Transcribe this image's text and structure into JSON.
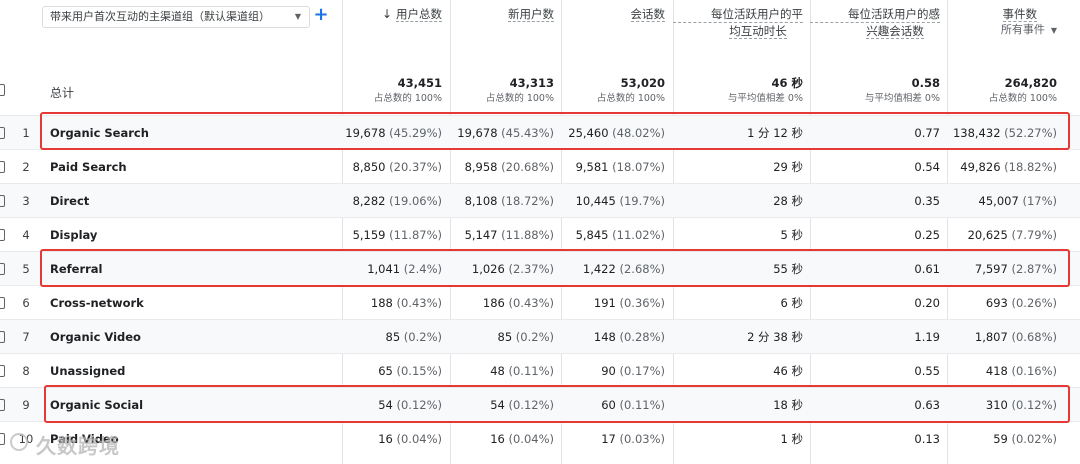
{
  "toolbar": {
    "dimension_select_label": "带来用户首次互动的主渠道组（默认渠道组）",
    "add_dimension_label": "+"
  },
  "columns": [
    {
      "key": "users",
      "label": "用户总数",
      "sorted_desc": true
    },
    {
      "key": "new_users",
      "label": "新用户数"
    },
    {
      "key": "sessions",
      "label": "会话数"
    },
    {
      "key": "avg_engagement",
      "label_line1": "每位活跃用户的平",
      "label_line2": "均互动时长"
    },
    {
      "key": "engaged_sessions",
      "label_line1": "每位活跃用户的感",
      "label_line2": "兴趣会话数"
    },
    {
      "key": "events",
      "label_line1": "事件数",
      "label_line2": "所有事件"
    }
  ],
  "totals": {
    "label": "总计",
    "users": {
      "value": "43,451",
      "pct": "占总数的 100%"
    },
    "new_users": {
      "value": "43,313",
      "pct": "占总数的 100%"
    },
    "sessions": {
      "value": "53,020",
      "pct": "占总数的 100%"
    },
    "avg_engagement": {
      "value": "46 秒",
      "pct": "与平均值相差 0%"
    },
    "engaged_sessions": {
      "value": "0.58",
      "pct": "与平均值相差 0%"
    },
    "events": {
      "value": "264,820",
      "pct": "占总数的 100%"
    }
  },
  "rows": [
    {
      "idx": "1",
      "name": "Organic Search",
      "users": "19,678",
      "users_pct": "(45.29%)",
      "new_users": "19,678",
      "new_users_pct": "(45.43%)",
      "sessions": "25,460",
      "sessions_pct": "(48.02%)",
      "avg_engagement": "1 分 12 秒",
      "engaged_sessions": "0.77",
      "events": "138,432",
      "events_pct": "(52.27%)"
    },
    {
      "idx": "2",
      "name": "Paid Search",
      "users": "8,850",
      "users_pct": "(20.37%)",
      "new_users": "8,958",
      "new_users_pct": "(20.68%)",
      "sessions": "9,581",
      "sessions_pct": "(18.07%)",
      "avg_engagement": "29 秒",
      "engaged_sessions": "0.54",
      "events": "49,826",
      "events_pct": "(18.82%)"
    },
    {
      "idx": "3",
      "name": "Direct",
      "users": "8,282",
      "users_pct": "(19.06%)",
      "new_users": "8,108",
      "new_users_pct": "(18.72%)",
      "sessions": "10,445",
      "sessions_pct": "(19.7%)",
      "avg_engagement": "28 秒",
      "engaged_sessions": "0.35",
      "events": "45,007",
      "events_pct": "(17%)"
    },
    {
      "idx": "4",
      "name": "Display",
      "users": "5,159",
      "users_pct": "(11.87%)",
      "new_users": "5,147",
      "new_users_pct": "(11.88%)",
      "sessions": "5,845",
      "sessions_pct": "(11.02%)",
      "avg_engagement": "5 秒",
      "engaged_sessions": "0.25",
      "events": "20,625",
      "events_pct": "(7.79%)"
    },
    {
      "idx": "5",
      "name": "Referral",
      "users": "1,041",
      "users_pct": "(2.4%)",
      "new_users": "1,026",
      "new_users_pct": "(2.37%)",
      "sessions": "1,422",
      "sessions_pct": "(2.68%)",
      "avg_engagement": "55 秒",
      "engaged_sessions": "0.61",
      "events": "7,597",
      "events_pct": "(2.87%)"
    },
    {
      "idx": "6",
      "name": "Cross-network",
      "users": "188",
      "users_pct": "(0.43%)",
      "new_users": "186",
      "new_users_pct": "(0.43%)",
      "sessions": "191",
      "sessions_pct": "(0.36%)",
      "avg_engagement": "6 秒",
      "engaged_sessions": "0.20",
      "events": "693",
      "events_pct": "(0.26%)"
    },
    {
      "idx": "7",
      "name": "Organic Video",
      "users": "85",
      "users_pct": "(0.2%)",
      "new_users": "85",
      "new_users_pct": "(0.2%)",
      "sessions": "148",
      "sessions_pct": "(0.28%)",
      "avg_engagement": "2 分 38 秒",
      "engaged_sessions": "1.19",
      "events": "1,807",
      "events_pct": "(0.68%)"
    },
    {
      "idx": "8",
      "name": "Unassigned",
      "users": "65",
      "users_pct": "(0.15%)",
      "new_users": "48",
      "new_users_pct": "(0.11%)",
      "sessions": "90",
      "sessions_pct": "(0.17%)",
      "avg_engagement": "46 秒",
      "engaged_sessions": "0.55",
      "events": "418",
      "events_pct": "(0.16%)"
    },
    {
      "idx": "9",
      "name": "Organic Social",
      "users": "54",
      "users_pct": "(0.12%)",
      "new_users": "54",
      "new_users_pct": "(0.12%)",
      "sessions": "60",
      "sessions_pct": "(0.11%)",
      "avg_engagement": "18 秒",
      "engaged_sessions": "0.63",
      "events": "310",
      "events_pct": "(0.12%)"
    },
    {
      "idx": "10",
      "name": "Paid Video",
      "users": "16",
      "users_pct": "(0.04%)",
      "new_users": "16",
      "new_users_pct": "(0.04%)",
      "sessions": "17",
      "sessions_pct": "(0.03%)",
      "avg_engagement": "1 秒",
      "engaged_sessions": "0.13",
      "events": "59",
      "events_pct": "(0.02%)"
    }
  ],
  "highlight_color": "#e53935",
  "watermark": "久数跨境"
}
